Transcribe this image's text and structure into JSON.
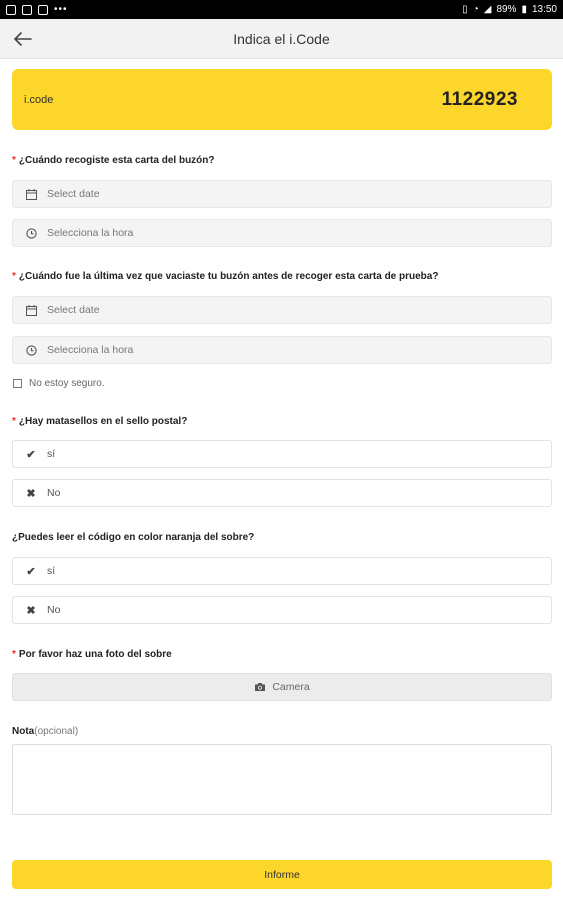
{
  "status_bar": {
    "battery": "89%",
    "time": "13:50",
    "left_icons": [
      "notification-icon",
      "photo-icon",
      "flipboard-icon"
    ],
    "overflow": "•••"
  },
  "app_bar": {
    "title": "Indica el i.Code",
    "back_icon": "arrow-left-icon"
  },
  "code_card": {
    "label": "i.code",
    "value": "1122923",
    "color": "#fcd62a"
  },
  "questions": {
    "q1": {
      "required": "*",
      "text": "¿Cuándo recogiste esta carta del buzón?",
      "date_placeholder": "Select date",
      "time_placeholder": "Selecciona la hora"
    },
    "q2": {
      "required": "*",
      "text": "¿Cuándo fue la última vez que vaciaste tu buzón antes de recoger esta carta de prueba?",
      "date_placeholder": "Select date",
      "time_placeholder": "Selecciona la hora",
      "unsure_label": "No estoy seguro."
    },
    "q3": {
      "required": "*",
      "text": "¿Hay matasellos en el sello postal?",
      "yes": "sí",
      "no": "No"
    },
    "q4": {
      "text": "¿Puedes leer el código en color naranja del sobre?",
      "yes": "sí",
      "no": "No"
    },
    "q5": {
      "required": "*",
      "text": "Por favor haz una foto del sobre",
      "camera_label": "Camera"
    }
  },
  "note": {
    "label": "Nota",
    "optional": "(opcional)",
    "value": ""
  },
  "submit_label": "Informe",
  "colors": {
    "accent": "#fcd62a",
    "required": "#e3312d"
  }
}
